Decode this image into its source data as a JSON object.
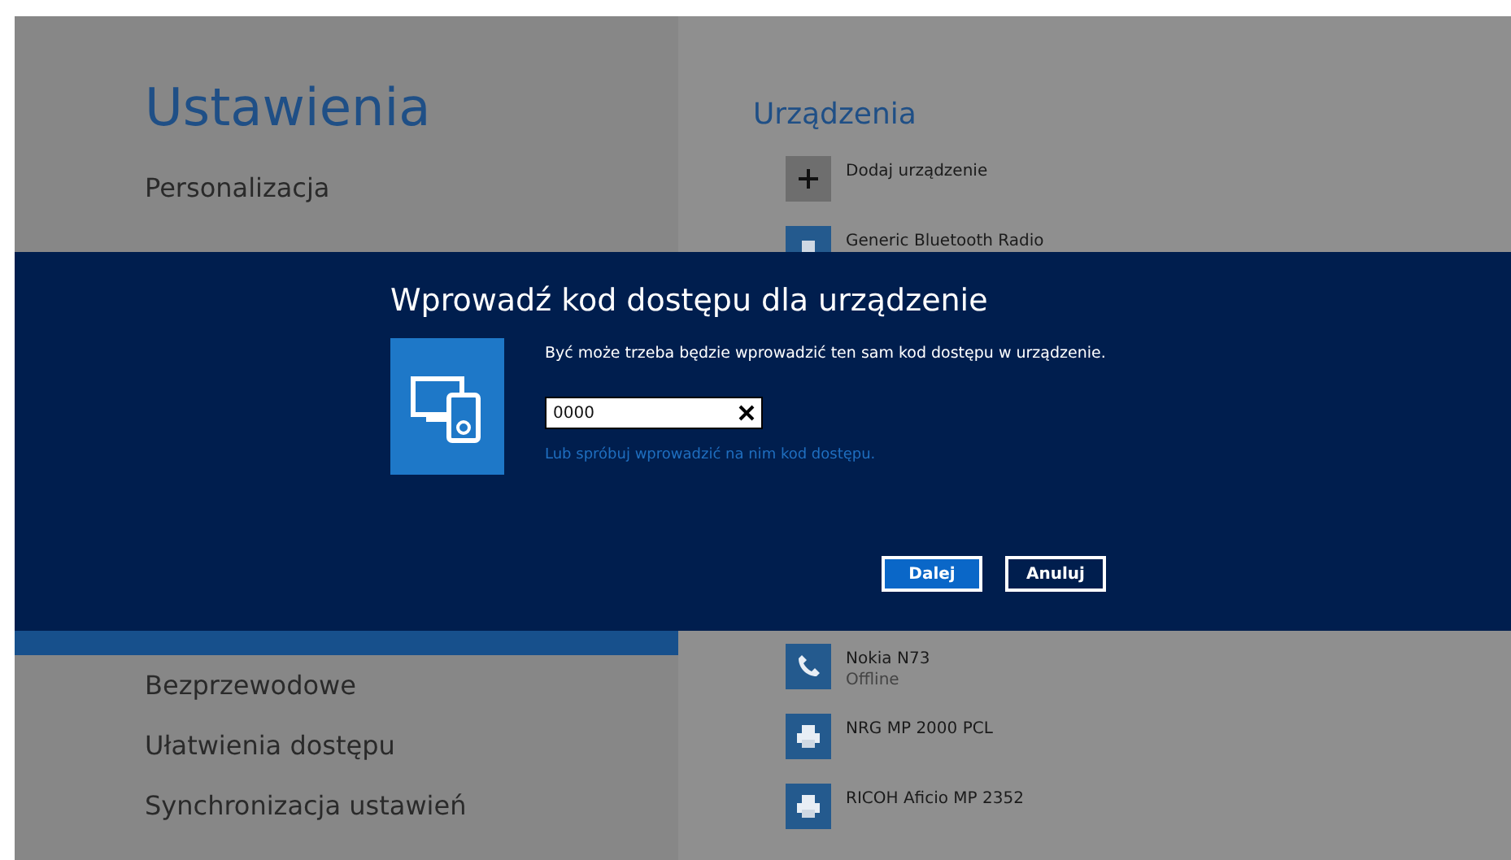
{
  "sidebar": {
    "title": "Ustawienia",
    "items_above": [
      {
        "label": "Personalizacja"
      }
    ],
    "items_below": [
      {
        "label": "Bezprzewodowe"
      },
      {
        "label": "Ułatwienia dostępu"
      },
      {
        "label": "Synchronizacja ustawień"
      }
    ]
  },
  "devices": {
    "heading": "Urządzenia",
    "items_above": [
      {
        "kind": "add",
        "name": "Dodaj urządzenie"
      },
      {
        "kind": "bluetooth",
        "name": "Generic Bluetooth Radio"
      }
    ],
    "items_below": [
      {
        "kind": "phone",
        "name": "Nokia N73",
        "status": "Offline"
      },
      {
        "kind": "printer",
        "name": "NRG MP 2000 PCL"
      },
      {
        "kind": "printer",
        "name": "RICOH Aficio MP 2352"
      }
    ]
  },
  "dialog": {
    "title": "Wprowadź kod dostępu dla urządzenie",
    "message": "Być może trzeba będzie wprowadzić ten sam kod dostępu w urządzenie.",
    "passcode": {
      "value": "0000"
    },
    "link": "Lub spróbuj wprowadzić na nim kod dostępu.",
    "buttons": [
      {
        "label": "Dalej",
        "kind": "primary"
      },
      {
        "label": "Anuluj",
        "kind": "secondary"
      }
    ]
  }
}
